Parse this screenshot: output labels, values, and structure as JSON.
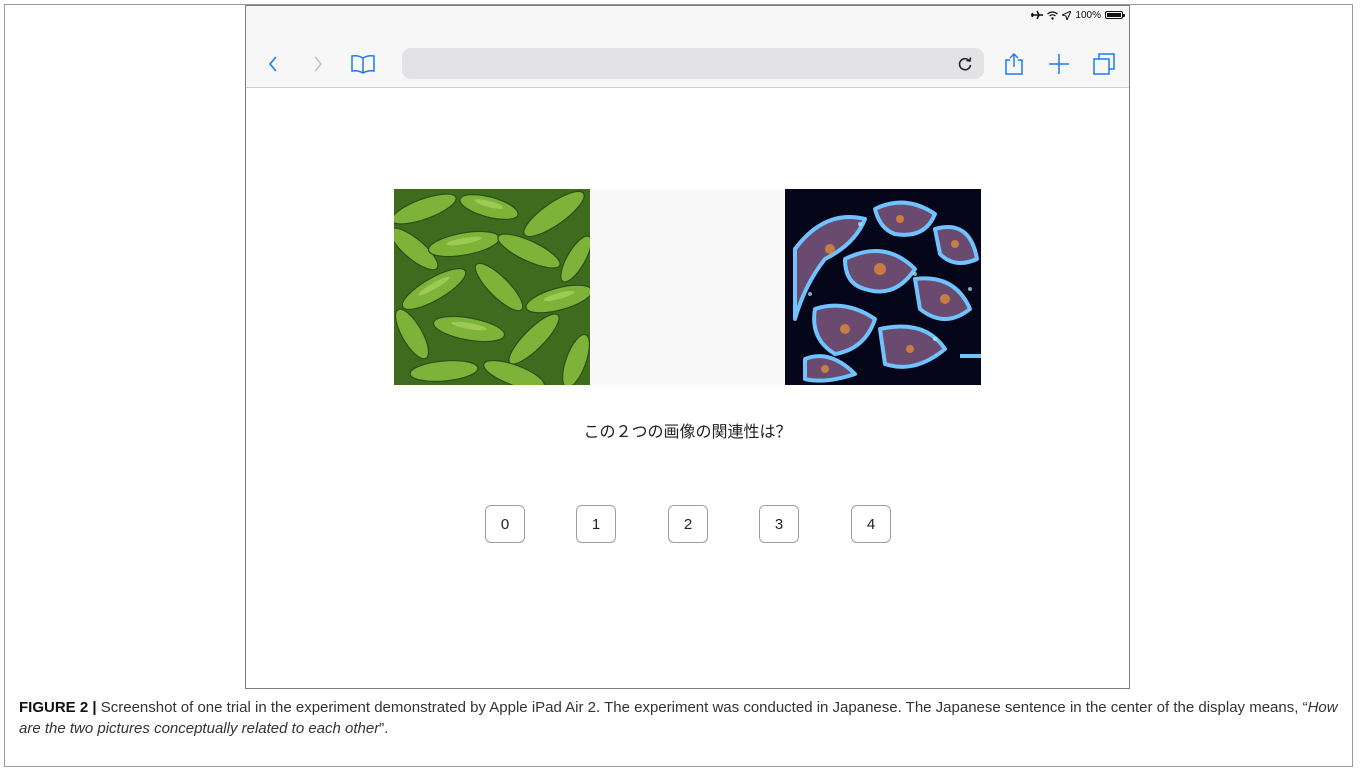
{
  "status": {
    "battery": "100%",
    "battery_level": 1.0
  },
  "toolbar": {
    "back": "chevron-left-icon",
    "forward": "chevron-right-icon",
    "bookmarks": "book-icon",
    "reload": "reload-icon",
    "share": "share-icon",
    "new_tab": "plus-icon",
    "tabs": "tabs-icon",
    "accent_color": "#1a7af2"
  },
  "trial": {
    "question": "この２つの画像の関連性は？",
    "scale_options": [
      "0",
      "1",
      "2",
      "3",
      "4"
    ]
  },
  "caption": {
    "label": "FIGURE 2",
    "separator": "|",
    "text": " Screenshot of one trial in the experiment demonstrated by Apple iPad Air 2. The experiment was conducted in Japanese. The Japanese sentence in the center of the display means, “",
    "quote": "How are the two pictures conceptually related to each other",
    "end": "”."
  }
}
